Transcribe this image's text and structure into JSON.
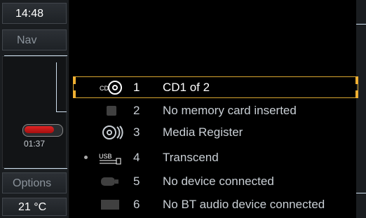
{
  "sidebar": {
    "time": "14:48",
    "nav": "Nav",
    "elapsed": "01:37",
    "options": "Options",
    "temperature": "21 °C",
    "progress": 0.8
  },
  "media_list": {
    "items": [
      {
        "num": "1",
        "label": "CD1 of 2",
        "icon": "cd-icon",
        "selected": true
      },
      {
        "num": "2",
        "label": "No memory card inserted",
        "icon": "memory-card-icon"
      },
      {
        "num": "3",
        "label": "Media Register",
        "icon": "media-register-icon"
      },
      {
        "num": "4",
        "label": "Transcend",
        "icon": "usb-icon",
        "active": true
      },
      {
        "num": "5",
        "label": "No device connected",
        "icon": "device-icon"
      },
      {
        "num": "6",
        "label": "No BT audio device connected",
        "icon": "bt-audio-icon"
      }
    ]
  },
  "colors": {
    "selection": "#f0b032",
    "progress": "#d01a1a"
  }
}
